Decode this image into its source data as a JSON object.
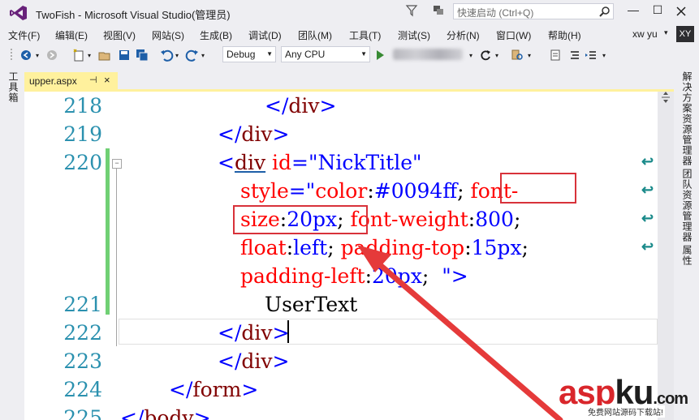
{
  "window": {
    "title": "TwoFish - Microsoft Visual Studio(管理员)",
    "quick_launch_placeholder": "快速启动 (Ctrl+Q)",
    "minimize": "—",
    "maximize": "☐"
  },
  "menu": {
    "items": [
      "文件(F)",
      "编辑(E)",
      "视图(V)",
      "网站(S)",
      "生成(B)",
      "调试(D)",
      "团队(M)",
      "工具(T)",
      "测试(S)",
      "分析(N)",
      "窗口(W)",
      "帮助(H)"
    ],
    "user_name": "xw yu",
    "avatar": "XY"
  },
  "toolbar": {
    "config": "Debug",
    "platform": "Any CPU"
  },
  "sidebars": {
    "left": "工具箱",
    "right_1": "解决方案资源管理器",
    "right_2": "团队资源管理器",
    "right_3": "属性"
  },
  "document_tab": {
    "label": "upper.aspx",
    "pin": "⊣",
    "close": "×"
  },
  "editor": {
    "line_numbers": [
      "218",
      "219",
      "220",
      "221",
      "222",
      "223",
      "224",
      "225"
    ]
  },
  "watermark": {
    "red": "asp",
    "black": "ku",
    "tld": ".com",
    "sub": "免费网站源码下载站!"
  }
}
